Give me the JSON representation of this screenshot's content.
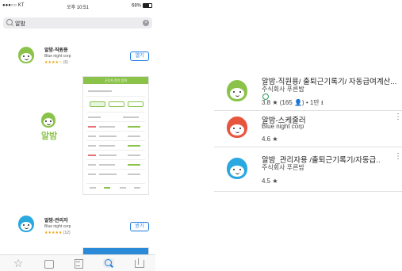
{
  "ios": {
    "status": {
      "carrier": "●●●○○ KT",
      "time": "오후 10:51",
      "battery": "68%"
    },
    "search": {
      "query": "알밤"
    },
    "apps": [
      {
        "title": "알밤-직원용",
        "developer": "Blue night corp",
        "stars": "★★★★☆",
        "count": "(6)",
        "button": "열기"
      },
      {
        "title": "알밤-관리자",
        "developer": "Blue night corp",
        "stars": "★★★★★",
        "count": "(12)",
        "button": "받기"
      }
    ],
    "splash_word": "알밤",
    "screenshot_bar": "근무자 찾기 입력"
  },
  "play": {
    "items": [
      {
        "title": "알밤-직원용/ 출퇴근기록기/ 자동급여계산...",
        "developer": "주식회사 푸른밤",
        "rating": "3.8 ★ (165 👤) • 1만 ⭳"
      },
      {
        "title": "알밤-스케줄러",
        "developer": "Blue night corp",
        "rating": "4.6 ★"
      },
      {
        "title": "알밤_관리자용 /출퇴근기록기/자동급..",
        "developer": "주식회사 푸른밤",
        "rating": "4.5 ★"
      }
    ],
    "more_glyph": "⋮"
  },
  "colors": {
    "green": "#8bc34a",
    "red": "#e8553e",
    "blue": "#2aa8e0",
    "ios_blue": "#1a7ce5"
  },
  "icons": [
    "search-icon",
    "clear-icon",
    "featured-star-icon",
    "categories-icon",
    "list-icon",
    "search-tab-icon",
    "updates-icon",
    "more-vert-icon",
    "installed-clock-icon"
  ]
}
